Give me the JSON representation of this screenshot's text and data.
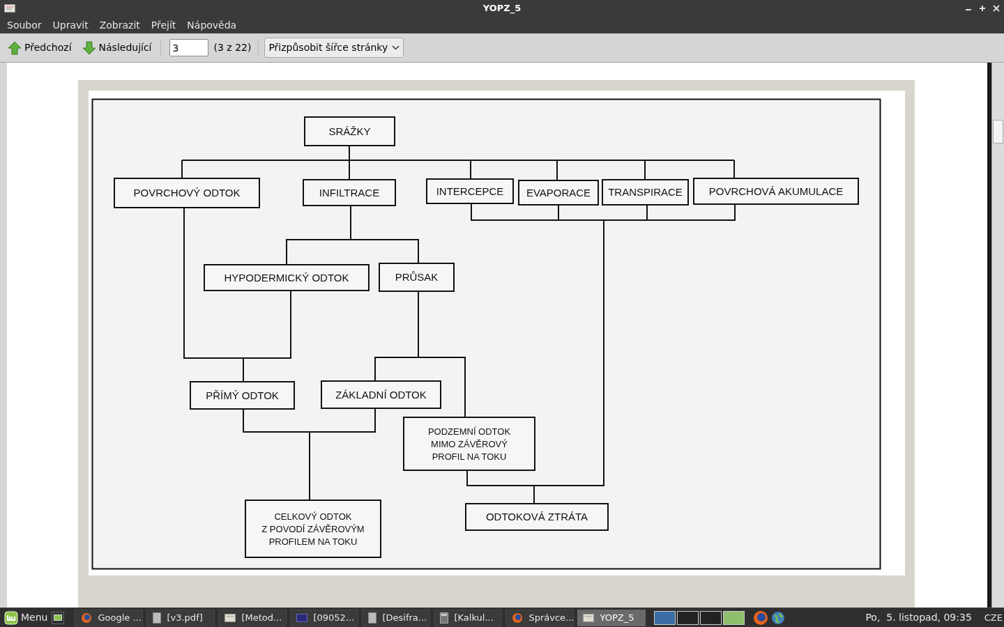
{
  "window": {
    "title": "YOPZ_5"
  },
  "menu": [
    "Soubor",
    "Upravit",
    "Zobrazit",
    "Přejít",
    "Nápověda"
  ],
  "toolbar": {
    "previous": "Předchozí",
    "next": "Následující",
    "page_field": {
      "value": "3"
    },
    "page_count": "(3 z 22)",
    "zoom": "Přizpůsobit šířce stránky"
  },
  "diagram": {
    "nodes": [
      {
        "lines": [
          "SRÁŽKY"
        ]
      },
      {
        "lines": [
          "POVRCHOVÝ ODTOK"
        ]
      },
      {
        "lines": [
          "INFILTRACE"
        ]
      },
      {
        "lines": [
          "INTERCEPCE"
        ]
      },
      {
        "lines": [
          "EVAPORACE"
        ]
      },
      {
        "lines": [
          "TRANSPIRACE"
        ]
      },
      {
        "lines": [
          "POVRCHOVÁ AKUMULACE"
        ]
      },
      {
        "lines": [
          "HYPODERMICKÝ ODTOK"
        ]
      },
      {
        "lines": [
          "PRŮSAK"
        ]
      },
      {
        "lines": [
          "PŘÍMÝ ODTOK"
        ]
      },
      {
        "lines": [
          "ZÁKLADNÍ ODTOK"
        ]
      },
      {
        "lines": [
          "PODZEMNÍ ODTOK",
          "MIMO ZÁVĚROVÝ",
          "PROFIL NA TOKU"
        ]
      },
      {
        "lines": [
          "CELKOVÝ ODTOK",
          "Z POVODÍ ZÁVĚROVÝM",
          "PROFILEM NA TOKU"
        ]
      },
      {
        "lines": [
          "ODTOKOVÁ ZTRÁTA"
        ]
      }
    ]
  },
  "taskbar": {
    "menu_label": "Menu",
    "tasks": [
      {
        "label": "Google ...",
        "kind": "browser",
        "selected": false
      },
      {
        "label": "[v3.pdf]",
        "kind": "document",
        "selected": false
      },
      {
        "label": "[Metod...",
        "kind": "viewer",
        "selected": false
      },
      {
        "label": "[09052...",
        "kind": "window",
        "selected": false
      },
      {
        "label": "[Desifra...",
        "kind": "document",
        "selected": false
      },
      {
        "label": "[Kalkul...",
        "kind": "calculator",
        "selected": false
      },
      {
        "label": "Správce...",
        "kind": "browser",
        "selected": false
      },
      {
        "label": "YOPZ_5",
        "kind": "viewer",
        "selected": true
      }
    ],
    "clock": "Po,  5. listopad, 09:35",
    "keyboard": "CZE"
  }
}
